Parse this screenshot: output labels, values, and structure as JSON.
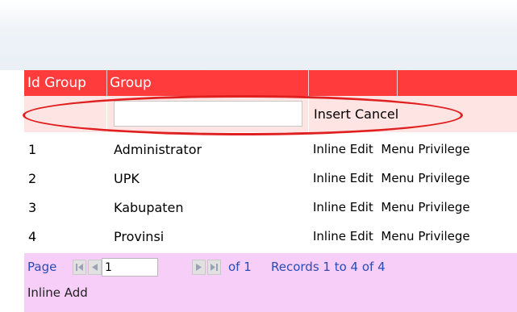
{
  "grid": {
    "columns": [
      "Id Group",
      "Group",
      "",
      ""
    ],
    "insert_row": {
      "input_value": "",
      "insert_label": "Insert",
      "cancel_label": "Cancel"
    },
    "rows": [
      {
        "id": "1",
        "group": "Administrator",
        "action_edit": "Inline Edit",
        "action_menu": "Menu Privilege"
      },
      {
        "id": "2",
        "group": "UPK",
        "action_edit": "Inline Edit",
        "action_menu": "Menu Privilege"
      },
      {
        "id": "3",
        "group": "Kabupaten",
        "action_edit": "Inline Edit",
        "action_menu": "Menu Privilege"
      },
      {
        "id": "4",
        "group": "Provinsi",
        "action_edit": "Inline Edit",
        "action_menu": "Menu Privilege"
      }
    ]
  },
  "pager": {
    "page_label": "Page",
    "page_value": "1",
    "of_label": "of 1",
    "records_label": "Records 1 to 4 of 4",
    "inline_add_label": "Inline Add",
    "icons": [
      "first-page-icon",
      "prev-page-icon",
      "next-page-icon",
      "last-page-icon"
    ]
  },
  "colors": {
    "header": "#ff3b3b",
    "insert_row": "#ffe4e4",
    "pager_bg": "#f6cef7",
    "link_blue": "#2b4bb5",
    "highlight_ellipse": "#e02020"
  }
}
